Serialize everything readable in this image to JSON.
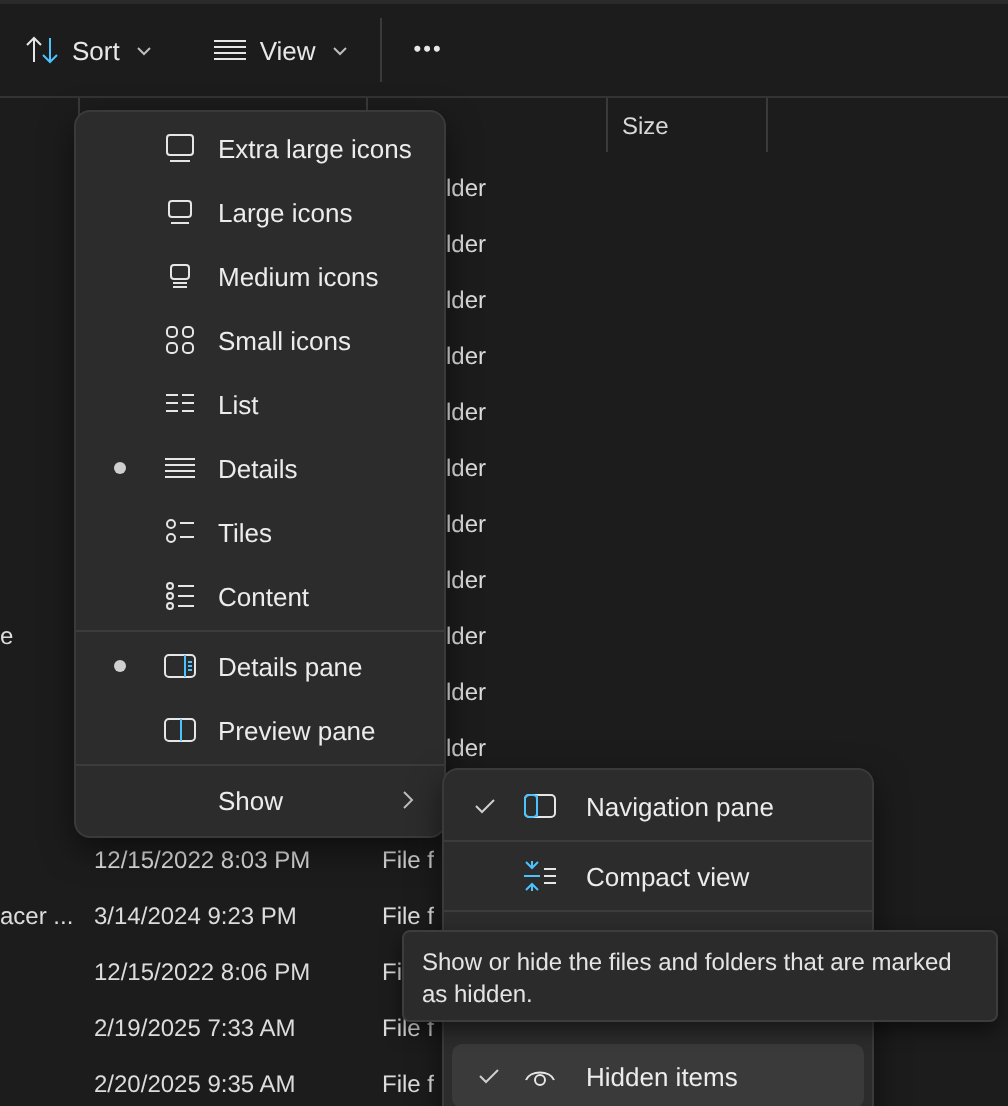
{
  "toolbar": [
    {
      "label": "Sort",
      "kind": "dropdown"
    },
    {
      "label": "View",
      "kind": "dropdown"
    },
    {
      "label": "•••",
      "kind": "more"
    }
  ],
  "table": {
    "columns": [
      {},
      {},
      {},
      {
        "label": "Size"
      }
    ],
    "rows": [
      {
        "type": "lder"
      },
      {
        "type": "lder"
      },
      {
        "type": "lder"
      },
      {
        "type": "lder"
      },
      {
        "type": "lder"
      },
      {
        "type": "lder"
      },
      {
        "type": "lder"
      },
      {
        "type": "lder"
      },
      {
        "name": "e",
        "type": "lder"
      },
      {
        "type": "lder"
      },
      {
        "type": "lder"
      },
      {
        "date": "12/15/2022 8:03 PM",
        "type": "File f"
      },
      {
        "name": "acer ...",
        "date": "3/14/2024 9:23 PM",
        "type": "File f"
      },
      {
        "date": "12/15/2022 8:06 PM",
        "type": "Fi"
      },
      {
        "date": "2/19/2025 7:33 AM",
        "type": "File f"
      },
      {
        "date": "2/20/2025 9:35 AM",
        "type": "File f"
      }
    ]
  },
  "view_menu": {
    "groups": [
      {
        "items": [
          {
            "label": "Extra large icons",
            "kind": "radio",
            "selected": false
          },
          {
            "label": "Large icons",
            "kind": "radio",
            "selected": false
          },
          {
            "label": "Medium icons",
            "kind": "radio",
            "selected": false
          },
          {
            "label": "Small icons",
            "kind": "radio",
            "selected": false
          },
          {
            "label": "List",
            "kind": "radio",
            "selected": false
          },
          {
            "label": "Details",
            "kind": "radio",
            "selected": true
          },
          {
            "label": "Tiles",
            "kind": "radio",
            "selected": false
          },
          {
            "label": "Content",
            "kind": "radio",
            "selected": false
          }
        ]
      },
      {
        "items": [
          {
            "label": "Details pane",
            "kind": "radio",
            "selected": true
          },
          {
            "label": "Preview pane",
            "kind": "radio",
            "selected": false
          }
        ]
      },
      {
        "items": [
          {
            "label": "Show",
            "kind": "submenu"
          }
        ]
      }
    ]
  },
  "show_submenu": {
    "groups": [
      {
        "items": [
          {
            "label": "Navigation pane",
            "checked": true,
            "hovered": false
          }
        ]
      },
      {
        "items": [
          {
            "label": "Compact view",
            "checked": false,
            "hovered": false
          }
        ]
      },
      {
        "items": [
          {
            "label": "Hidden items",
            "checked": true,
            "hovered": true
          }
        ]
      }
    ]
  },
  "tooltip": {
    "text": "Show or hide the files and folders that are marked as hidden."
  }
}
